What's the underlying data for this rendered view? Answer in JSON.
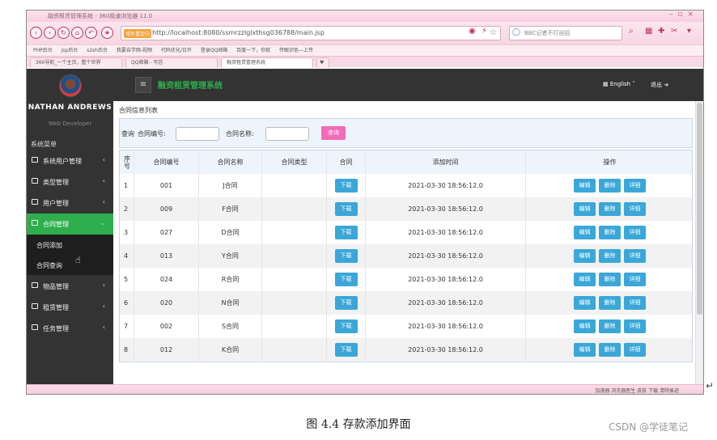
{
  "browser": {
    "window_title": "融资租赁管理系统 - 360极速浏览器 11.0",
    "url_tag": "域名重定向",
    "url": "http://localhost:8080/ssmrzzlglxthsg036788/main.jsp",
    "search_placeholder": "BBC记者不打自招",
    "bookmarks": [
      "PHP后台",
      "jsp后台",
      "s2sh后台",
      "我要自学网-视频",
      "代码优化/日开",
      "登录QQ邮箱",
      "百度一下，你就",
      "传眼识色—上传"
    ],
    "tabs": [
      "360导航_一个主页，整个世界",
      "QQ邮箱 - 写信",
      "融资租赁管理系统"
    ],
    "status_text": "加速器  浏览器医生  皮肤  下载  清除痕迹"
  },
  "user": {
    "name": "NATHAN ANDREWS",
    "role": "Web Developer"
  },
  "sidebar": {
    "title": "系统菜单",
    "menus": [
      "系统用户管理",
      "类型管理",
      "用户管理",
      "合同管理",
      "物品管理",
      "租赁管理",
      "任务管理"
    ],
    "submenus": [
      "合同添加",
      "合同查询"
    ]
  },
  "topbar": {
    "system_title": "融资租赁管理系统",
    "language": "English",
    "logout": "退出"
  },
  "content": {
    "page_title": "合同信息列表",
    "search_label": "查询",
    "filter_number_label": "合同编号:",
    "filter_name_label": "合同名称:",
    "search_button": "查询"
  },
  "table": {
    "headers": [
      "序号",
      "合同编号",
      "合同名称",
      "合同类型",
      "合同",
      "添加时间",
      "操作"
    ],
    "download_label": "下载",
    "edit_label": "编辑",
    "delete_label": "删除",
    "detail_label": "详细",
    "rows": [
      {
        "seq": "1",
        "number": "001",
        "name": "J合同",
        "type": "",
        "time": "2021-03-30 18:56:12.0"
      },
      {
        "seq": "2",
        "number": "009",
        "name": "F合同",
        "type": "",
        "time": "2021-03-30 18:56:12.0"
      },
      {
        "seq": "3",
        "number": "027",
        "name": "D合同",
        "type": "",
        "time": "2021-03-30 18:56:12.0"
      },
      {
        "seq": "4",
        "number": "013",
        "name": "Y合同",
        "type": "",
        "time": "2021-03-30 18:56:12.0"
      },
      {
        "seq": "5",
        "number": "024",
        "name": "R合同",
        "type": "",
        "time": "2021-03-30 18:56:12.0"
      },
      {
        "seq": "6",
        "number": "020",
        "name": "N合同",
        "type": "",
        "time": "2021-03-30 18:56:12.0"
      },
      {
        "seq": "7",
        "number": "002",
        "name": "S合同",
        "type": "",
        "time": "2021-03-30 18:56:12.0"
      },
      {
        "seq": "8",
        "number": "012",
        "name": "K合同",
        "type": "",
        "time": "2021-03-30 18:56:12.0"
      }
    ]
  },
  "caption": "图 4.4 存款添加界面",
  "watermark": "CSDN @学徒笔记"
}
